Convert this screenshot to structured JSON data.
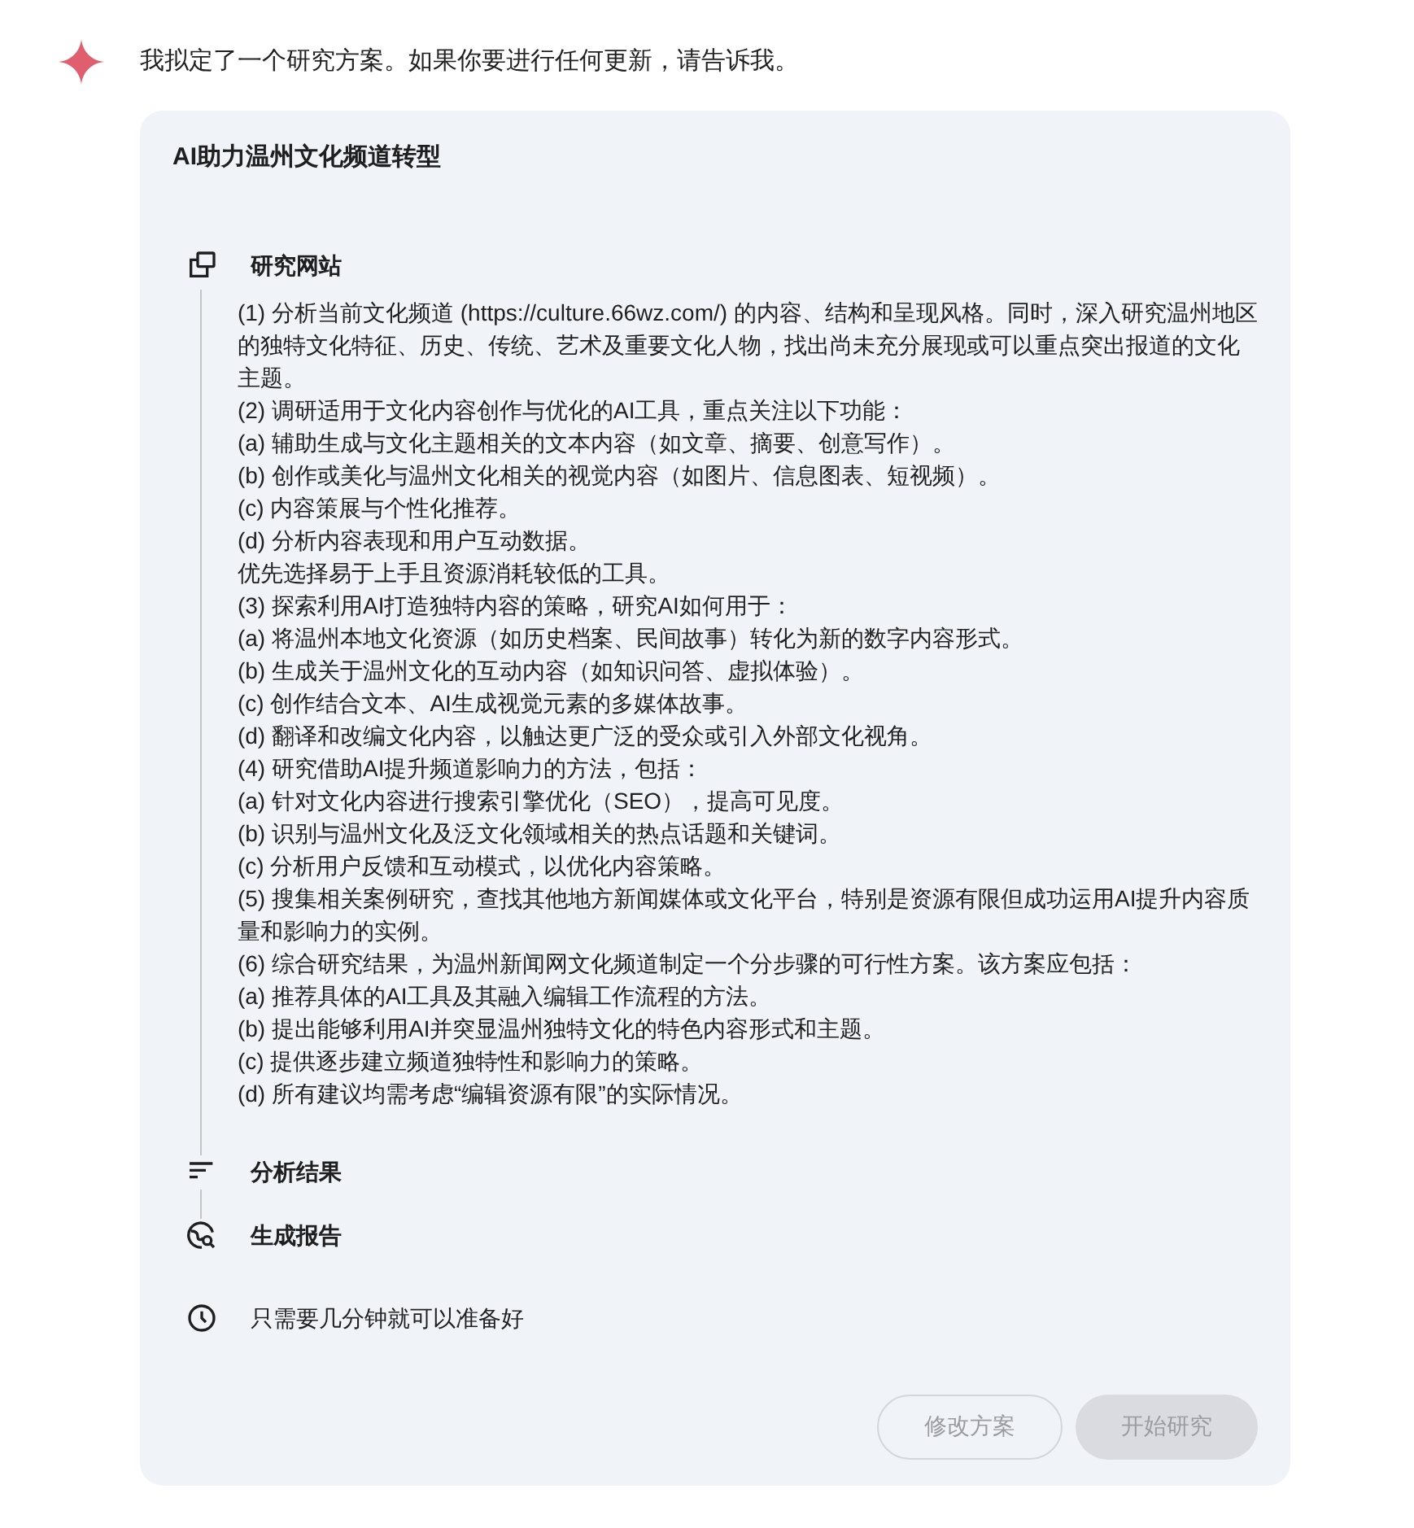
{
  "message": "我拟定了一个研究方案。如果你要进行任何更新，请告诉我。",
  "plan": {
    "title": "AI助力温州文化频道转型",
    "steps": [
      {
        "kind": "website",
        "label": "研究网站",
        "details": [
          "(1) 分析当前文化频道 (https://culture.66wz.com/) 的内容、结构和呈现风格。同时，深入研究温州地区的独特文化特征、历史、传统、艺术及重要文化人物，找出尚未充分展现或可以重点突出报道的文化主题。",
          "(2) 调研适用于文化内容创作与优化的AI工具，重点关注以下功能：",
          "(a) 辅助生成与文化主题相关的文本内容（如文章、摘要、创意写作）。",
          "(b) 创作或美化与温州文化相关的视觉内容（如图片、信息图表、短视频）。",
          "(c) 内容策展与个性化推荐。",
          "(d) 分析内容表现和用户互动数据。",
          "优先选择易于上手且资源消耗较低的工具。",
          "(3) 探索利用AI打造独特内容的策略，研究AI如何用于：",
          "(a) 将温州本地文化资源（如历史档案、民间故事）转化为新的数字内容形式。",
          "(b) 生成关于温州文化的互动内容（如知识问答、虚拟体验）。",
          "(c) 创作结合文本、AI生成视觉元素的多媒体故事。",
          "(d) 翻译和改编文化内容，以触达更广泛的受众或引入外部文化视角。",
          "(4) 研究借助AI提升频道影响力的方法，包括：",
          "(a) 针对文化内容进行搜索引擎优化（SEO），提高可见度。",
          "(b) 识别与温州文化及泛文化领域相关的热点话题和关键词。",
          "(c) 分析用户反馈和互动模式，以优化内容策略。",
          "(5) 搜集相关案例研究，查找其他地方新闻媒体或文化平台，特别是资源有限但成功运用AI提升内容质量和影响力的实例。",
          "(6) 综合研究结果，为温州新闻网文化频道制定一个分步骤的可行性方案。该方案应包括：",
          "(a) 推荐具体的AI工具及其融入编辑工作流程的方法。",
          "(b) 提出能够利用AI并突显温州独特文化的特色内容形式和主题。",
          "(c) 提供逐步建立频道独特性和影响力的策略。",
          "(d) 所有建议均需考虑“编辑资源有限”的实际情况。"
        ]
      },
      {
        "kind": "analyze",
        "label": "分析结果"
      },
      {
        "kind": "report",
        "label": "生成报告"
      }
    ],
    "eta": "只需要几分钟就可以准备好",
    "buttons": [
      {
        "kind": "outline",
        "label": "修改方案",
        "disabled": true
      },
      {
        "kind": "filled",
        "label": "开始研究",
        "disabled": true
      }
    ]
  }
}
